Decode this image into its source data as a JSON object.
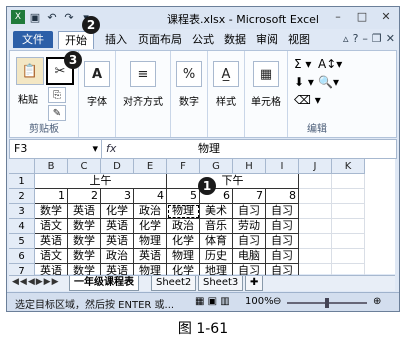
{
  "window": {
    "title": "课程表.xlsx - Microsoft Excel"
  },
  "ribbon": {
    "tabs": [
      "文件",
      "开始",
      "插入",
      "页面布局",
      "公式",
      "数据",
      "审阅",
      "视图"
    ],
    "active_tab": "开始",
    "groups": {
      "clipboard": {
        "paste": "粘贴",
        "label": "剪贴板"
      },
      "font": "字体",
      "alignment": "对齐方式",
      "number": "数字",
      "styles": "样式",
      "cells": "单元格",
      "editing": "编辑"
    }
  },
  "formula_bar": {
    "name_box": "F3",
    "fx": "fx",
    "value": "物理"
  },
  "grid": {
    "columns": [
      "B",
      "C",
      "D",
      "E",
      "F",
      "G",
      "H",
      "I",
      "J",
      "K"
    ],
    "rows": [
      "1",
      "2",
      "3",
      "4",
      "5",
      "6",
      "7"
    ],
    "header_am": "上午",
    "header_pm": "下午",
    "periods": [
      "1",
      "2",
      "3",
      "4",
      "5",
      "6",
      "7",
      "8"
    ],
    "schedule": [
      [
        "数学",
        "英语",
        "化学",
        "政治",
        "物理",
        "美术",
        "自习",
        "自习"
      ],
      [
        "语文",
        "数学",
        "英语",
        "化学",
        "政治",
        "音乐",
        "劳动",
        "自习"
      ],
      [
        "英语",
        "数学",
        "英语",
        "物理",
        "化学",
        "体育",
        "自习",
        "自习"
      ],
      [
        "语文",
        "数学",
        "政治",
        "英语",
        "物理",
        "历史",
        "电脑",
        "自习"
      ],
      [
        "英语",
        "数学",
        "英语",
        "物理",
        "化学",
        "地理",
        "自习",
        "自习"
      ]
    ]
  },
  "sheets": {
    "tabs": [
      "一年级课程表",
      "Sheet2",
      "Sheet3"
    ],
    "active": "一年级课程表"
  },
  "status": {
    "message": "选定目标区域，然后按 ENTER 或...",
    "zoom": "100%"
  },
  "callouts": [
    "1",
    "2",
    "3"
  ],
  "caption": "图 1-61"
}
